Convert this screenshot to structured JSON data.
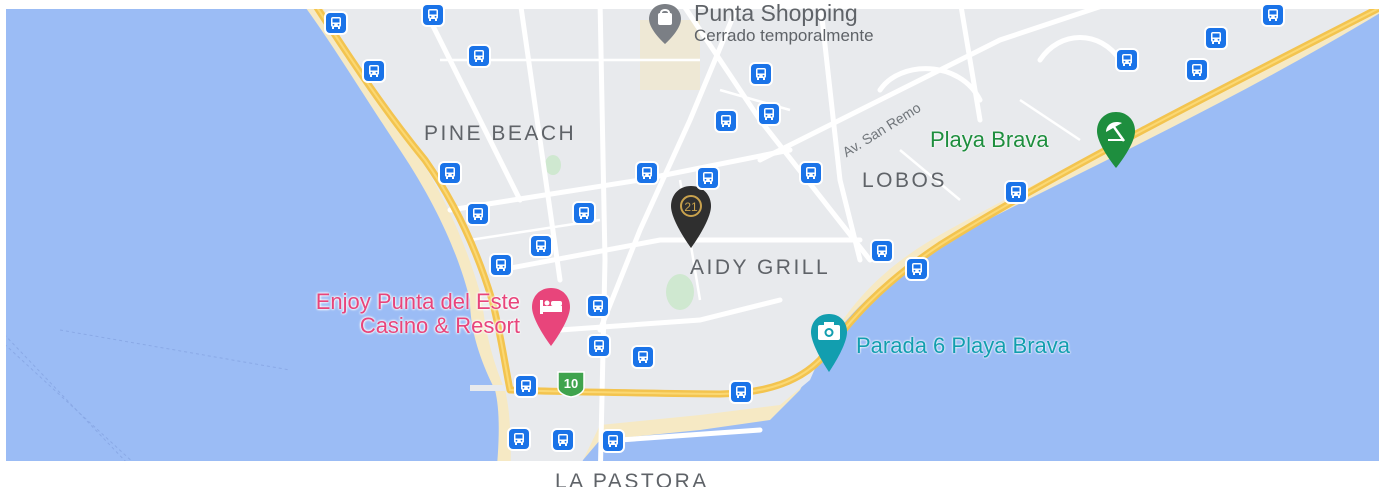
{
  "map": {
    "colors": {
      "water": "#9bbcf5",
      "land": "#e8eaed",
      "beach": "#f6e9c4",
      "highway": "#f3c44f",
      "road": "#ffffff",
      "park": "#cfe8d0",
      "bus_stop": "#1a73e8"
    },
    "area_labels": {
      "pine_beach": "PINE BEACH",
      "lobos": "LOBOS",
      "aidy_grill": "AIDY GRILL",
      "la_pastora": "LA PASTORA"
    },
    "street_labels": {
      "san_remo": "Av. San Remo"
    },
    "pois": {
      "punta_shopping": {
        "name": "Punta Shopping",
        "status": "Cerrado temporalmente",
        "icon": "shopping-bag-icon"
      },
      "enjoy": {
        "line1": "Enjoy Punta del Este",
        "line2": "Casino & Resort",
        "icon": "hotel-bed-icon"
      },
      "playa_brava": {
        "name": "Playa Brava",
        "icon": "beach-umbrella-icon"
      },
      "parada6": {
        "name": "Parada 6 Playa Brava",
        "icon": "camera-icon"
      },
      "century21": {
        "badge": "21",
        "icon": "map-pin-icon"
      }
    },
    "route_shield": {
      "number": "10"
    },
    "bus_stop_icon": "bus-icon"
  }
}
